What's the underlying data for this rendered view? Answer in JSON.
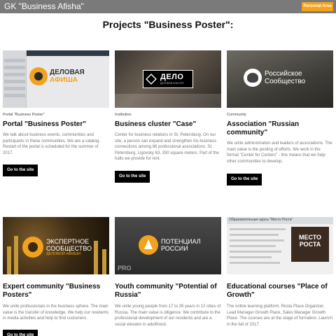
{
  "header": {
    "brand": "GK \"Business Afisha\"",
    "personal_area": "Personal Area"
  },
  "page_title": "Projects \"Business Poster\":",
  "cards": [
    {
      "category": "Portal \"Business Poster\"",
      "title": "Portal \"Business Poster\"",
      "description": "We talk about business events, communities and participants in these communities. We are a catalog. Restart of the portal is scheduled for the summer of 2017.",
      "button": "Go to the site",
      "thumb_text_1": "ДЕЛОВАЯ",
      "thumb_text_2": "АФИША"
    },
    {
      "category": "Institution",
      "title": "Business cluster \"Case\"",
      "description": "Center for business relations in St. Petersburg. On our site, a person can expand and strengthen his business connections among 86 professional associations. St. Petersburg, Ligovsky 63, 330 square meters. Part of the halls we provide for rent.",
      "button": "Go to the site",
      "thumb_text_1": "ДЕЛО",
      "thumb_text_2": "ДЕЛОВОЙ КЛАСТЕР"
    },
    {
      "category": "Community",
      "title": "Association \"Russian community\"",
      "description": "We unite administration and leaders of associations. The main value is the pooling of efforts. We work in the format \"Center for Centers\" - this means that we help other communities to develop.",
      "button": "Go to the site",
      "thumb_text_1": "Российское",
      "thumb_text_2": "Сообщество"
    },
    {
      "title": "Expert community \"Business Posters\"",
      "description": "We unite professionals in the business sphere. The main value is the transfer of knowledge. We help our residents in media activities and help to find customers.",
      "button": "Go to the site",
      "thumb_text_1": "ЭКСПЕРТНОЕ",
      "thumb_text_2": "СООБЩЕСТВО",
      "thumb_text_3": "ДЕЛОВОЙ АФИШИ"
    },
    {
      "title": "Youth community \"Potential of Russia\"",
      "description": "We unite young people from 17 to 26 years in 12 cities of Russia. The main value is diligence. We contribute to the professional development of our residents and are a social elevator in adulthood.",
      "thumb_text_1": "ПОТЕНЦИАЛ",
      "thumb_text_2": "РОССИИ",
      "thumb_text_3": "PRO"
    },
    {
      "title": "Educational courses \"Place of Growth\"",
      "description": "The online learning platform. Rosta Place Organizer, Lead Manager Growth Place, Sales Manager Growth Place. The courses are at the stage of formation. Launch in the fall of 2017.",
      "thumb_text_1": "Образовательные курсы \"Место Роста\"",
      "thumb_text_2": "МЕСТО",
      "thumb_text_3": "РОСТА"
    }
  ]
}
